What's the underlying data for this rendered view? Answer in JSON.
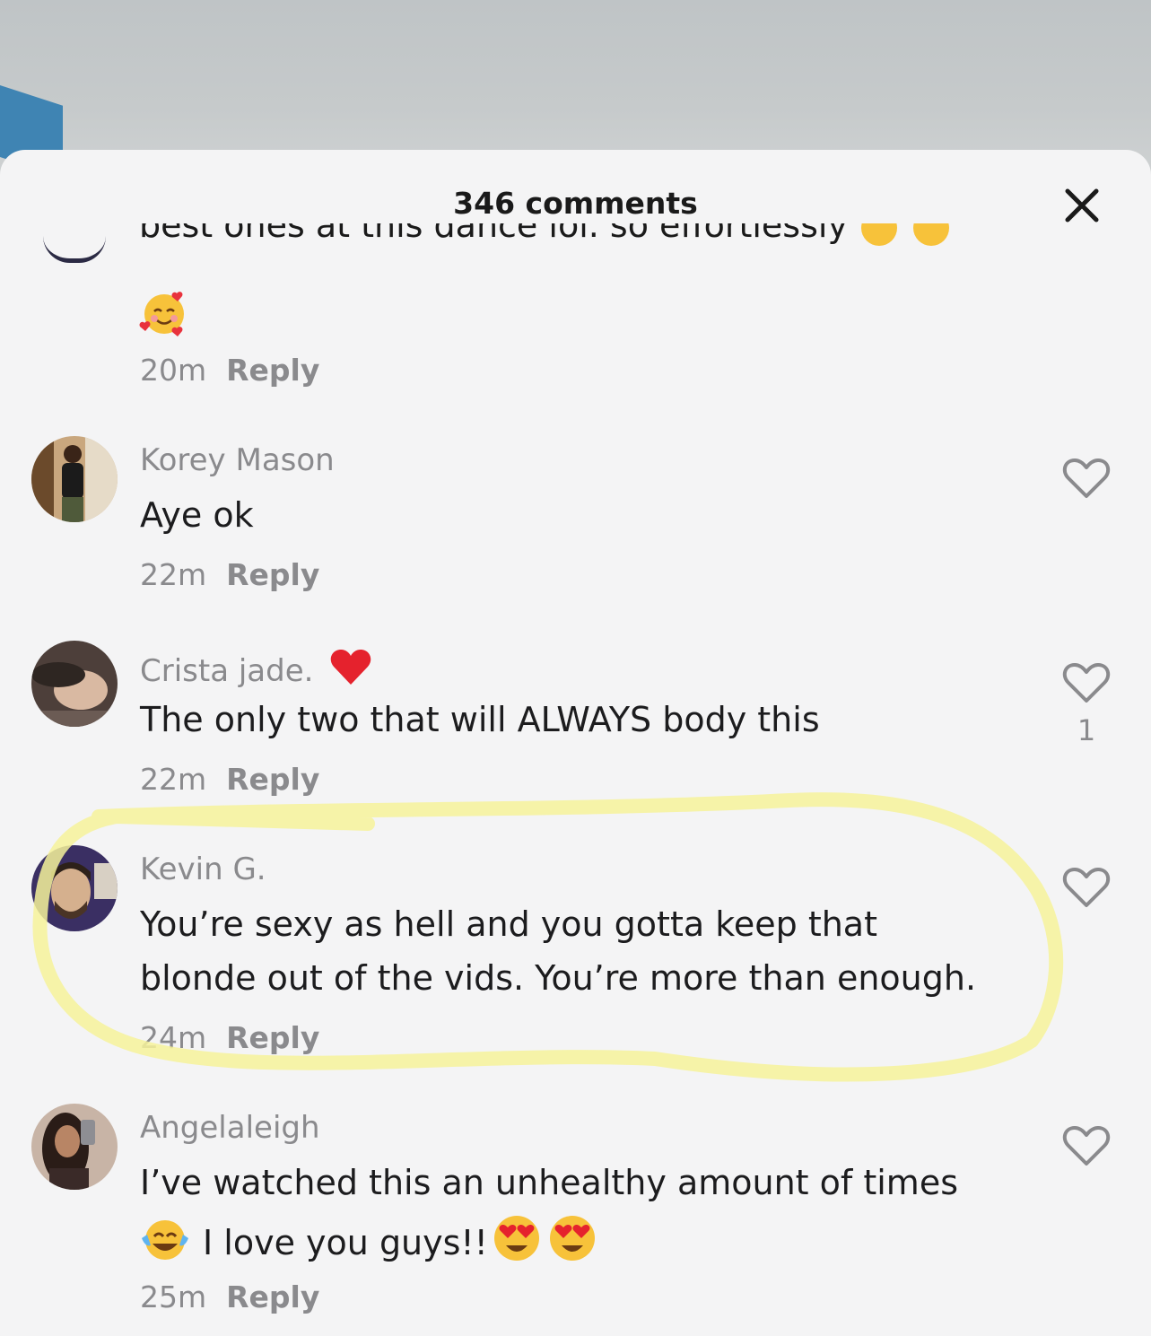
{
  "header": {
    "title": "346 comments",
    "close_icon": "close-icon"
  },
  "partial_comment": {
    "text": "best ones at this dance lol. so effortlessly",
    "time": "20m",
    "reply_label": "Reply"
  },
  "comments": [
    {
      "username": "Korey Mason",
      "text": [
        "Aye ok"
      ],
      "time": "22m",
      "reply_label": "Reply",
      "likes": ""
    },
    {
      "username": "Crista jade.",
      "text": [
        "The only two that will ALWAYS body this"
      ],
      "time": "22m",
      "reply_label": "Reply",
      "likes": "1"
    },
    {
      "username": "Kevin G.",
      "text": [
        "You’re sexy as hell and you gotta keep that",
        "blonde out of the vids. You’re more than enough."
      ],
      "time": "24m",
      "reply_label": "Reply",
      "likes": ""
    },
    {
      "username": "Angelaleigh",
      "text": [
        "I’ve watched this an unhealthy amount of times",
        "I love you guys!!"
      ],
      "time": "25m",
      "reply_label": "Reply",
      "likes": ""
    }
  ],
  "colors": {
    "sheet": "#f4f4f5",
    "muted": "#8a8a8d",
    "text": "#1c1c1e",
    "highlight": "#f6f29a"
  }
}
